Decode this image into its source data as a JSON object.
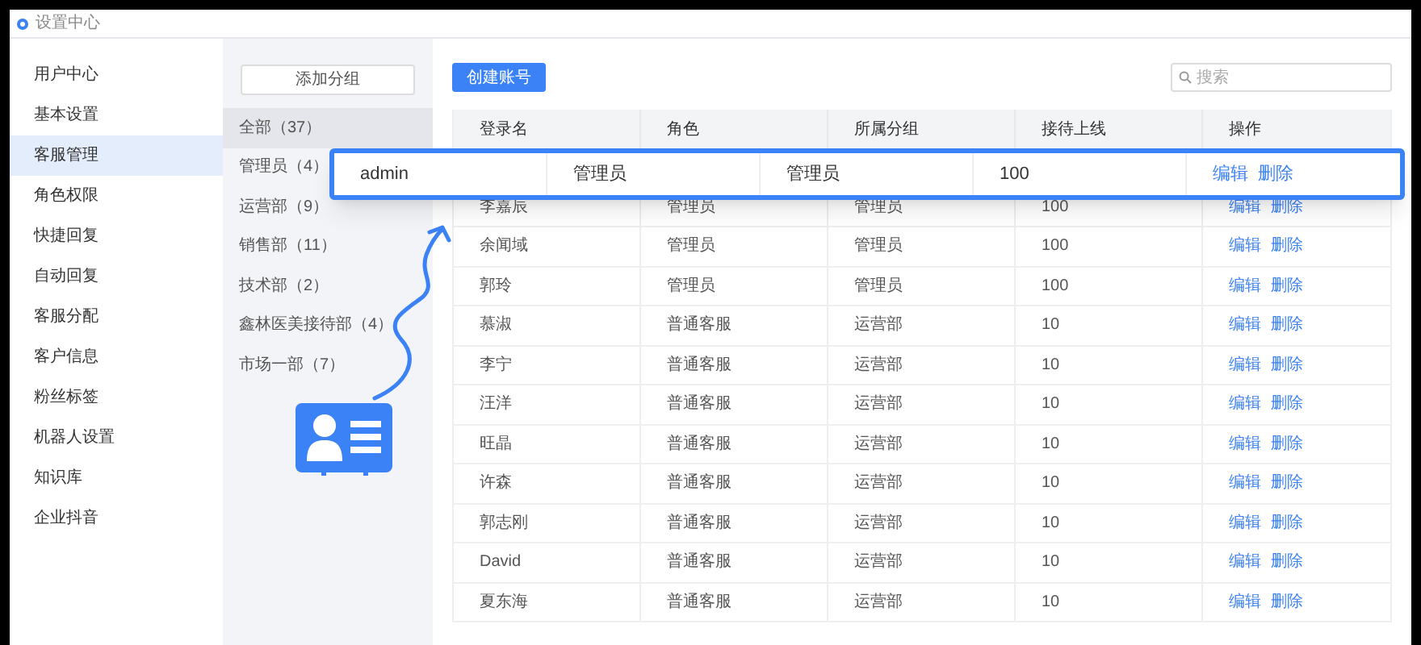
{
  "window": {
    "title": "设置中心"
  },
  "sidebar": {
    "items": [
      {
        "label": "用户中心",
        "selected": false
      },
      {
        "label": "基本设置",
        "selected": false
      },
      {
        "label": "客服管理",
        "selected": true
      },
      {
        "label": "角色权限",
        "selected": false
      },
      {
        "label": "快捷回复",
        "selected": false
      },
      {
        "label": "自动回复",
        "selected": false
      },
      {
        "label": "客服分配",
        "selected": false
      },
      {
        "label": "客户信息",
        "selected": false
      },
      {
        "label": "粉丝标签",
        "selected": false
      },
      {
        "label": "机器人设置",
        "selected": false
      },
      {
        "label": "知识库",
        "selected": false
      },
      {
        "label": "企业抖音",
        "selected": false
      }
    ]
  },
  "groups": {
    "add_button": "添加分组",
    "items": [
      {
        "label": "全部（37）",
        "selected": true
      },
      {
        "label": "管理员（4）",
        "selected": false
      },
      {
        "label": "运营部（9）",
        "selected": false
      },
      {
        "label": "销售部（11）",
        "selected": false
      },
      {
        "label": "技术部（2）",
        "selected": false
      },
      {
        "label": "鑫林医美接待部（4）",
        "selected": false
      },
      {
        "label": "市场一部（7）",
        "selected": false
      }
    ]
  },
  "toolbar": {
    "create_button": "创建账号",
    "search": {
      "placeholder": "搜索"
    }
  },
  "table": {
    "columns": [
      "登录名",
      "角色",
      "所属分组",
      "接待上线",
      "操作"
    ],
    "rows": [
      {
        "cells": [
          "admin",
          "管理员",
          "管理员",
          "100"
        ],
        "actions": [
          "编辑",
          "删除"
        ],
        "highlighted": true
      },
      {
        "cells": [
          "李嘉辰",
          "管理员",
          "管理员",
          "100"
        ],
        "actions": [
          "编辑",
          "删除"
        ],
        "highlighted": false
      },
      {
        "cells": [
          "余闻域",
          "管理员",
          "管理员",
          "100"
        ],
        "actions": [
          "编辑",
          "删除"
        ],
        "highlighted": false
      },
      {
        "cells": [
          "郭玲",
          "管理员",
          "管理员",
          "100"
        ],
        "actions": [
          "编辑",
          "删除"
        ],
        "highlighted": false
      },
      {
        "cells": [
          "慕淑",
          "普通客服",
          "运营部",
          "10"
        ],
        "actions": [
          "编辑",
          "删除"
        ],
        "highlighted": false
      },
      {
        "cells": [
          "李宁",
          "普通客服",
          "运营部",
          "10"
        ],
        "actions": [
          "编辑",
          "删除"
        ],
        "highlighted": false
      },
      {
        "cells": [
          "汪洋",
          "普通客服",
          "运营部",
          "10"
        ],
        "actions": [
          "编辑",
          "删除"
        ],
        "highlighted": false
      },
      {
        "cells": [
          "旺晶",
          "普通客服",
          "运营部",
          "10"
        ],
        "actions": [
          "编辑",
          "删除"
        ],
        "highlighted": false
      },
      {
        "cells": [
          "许森",
          "普通客服",
          "运营部",
          "10"
        ],
        "actions": [
          "编辑",
          "删除"
        ],
        "highlighted": false
      },
      {
        "cells": [
          "郭志刚",
          "普通客服",
          "运营部",
          "10"
        ],
        "actions": [
          "编辑",
          "删除"
        ],
        "highlighted": false
      },
      {
        "cells": [
          "David",
          "普通客服",
          "运营部",
          "10"
        ],
        "actions": [
          "编辑",
          "删除"
        ],
        "highlighted": false
      },
      {
        "cells": [
          "夏东海",
          "普通客服",
          "运营部",
          "10"
        ],
        "actions": [
          "编辑",
          "删除"
        ],
        "highlighted": false
      }
    ]
  }
}
